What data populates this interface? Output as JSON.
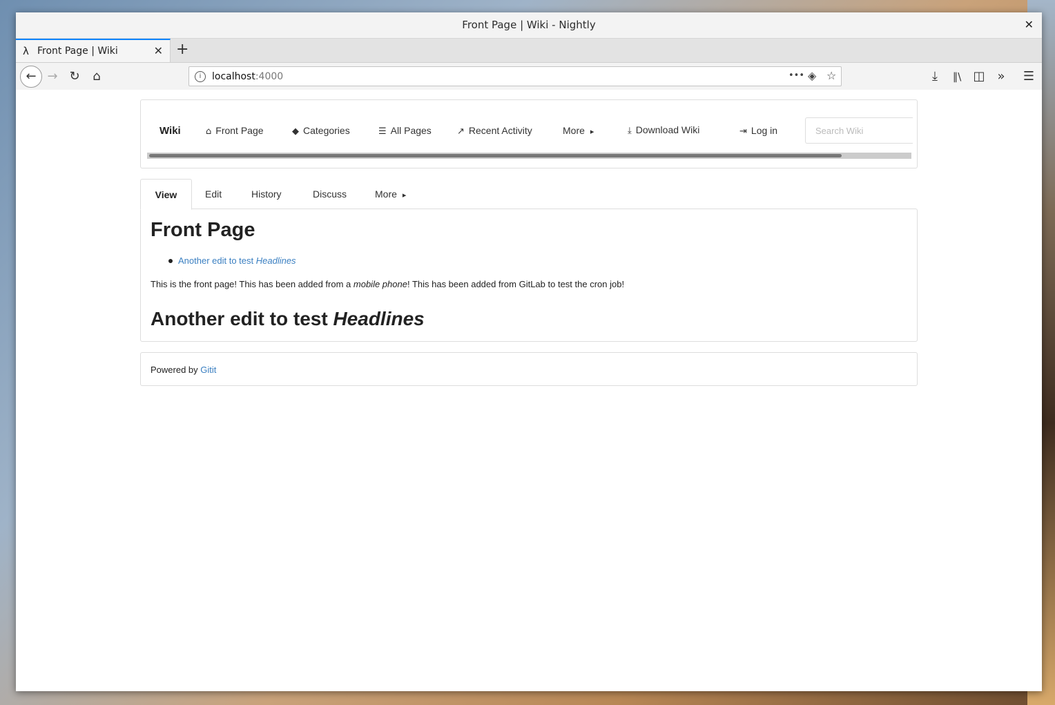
{
  "window": {
    "title": "Front Page | Wiki - Nightly",
    "close_glyph": "✕"
  },
  "browser": {
    "tab": {
      "favicon": "λ",
      "label": "Front Page | Wiki",
      "close_glyph": "✕"
    },
    "new_tab_glyph": "+",
    "url": {
      "host": "localhost",
      "port": ":4000"
    },
    "icons": {
      "back": "←",
      "forward": "→",
      "reload": "↻",
      "home": "⌂",
      "more": "•••",
      "pocket": "◈",
      "star": "☆",
      "download": "⤓",
      "library": "∥\\",
      "sidebar": "◫",
      "overflow": "»",
      "menu": "☰",
      "info": "i"
    }
  },
  "wiki_nav": {
    "brand": "Wiki",
    "items": [
      {
        "icon": "⌂",
        "label": "Front Page"
      },
      {
        "icon": "◆",
        "label": "Categories"
      },
      {
        "icon": "☰",
        "label": "All Pages"
      },
      {
        "icon": "↗",
        "label": "Recent Activity"
      },
      {
        "icon": "▸",
        "label": "More"
      },
      {
        "icon": "⤓",
        "label": "Download Wiki"
      },
      {
        "icon": "⇥",
        "label": "Log in"
      }
    ],
    "search_placeholder": "Search Wiki"
  },
  "page_tabs": [
    "View",
    "Edit",
    "History",
    "Discuss",
    "More"
  ],
  "page_tabs_more_caret": "▸",
  "content": {
    "title": "Front Page",
    "toc_link": {
      "text": "Another edit to test ",
      "em": "Headlines"
    },
    "paragraph": {
      "before": "This is the front page! This has been added from a ",
      "em": "mobile phone",
      "after": "! This has been added from GitLab to test the cron job!"
    },
    "heading2": {
      "text": "Another edit to test ",
      "em": "Headlines"
    }
  },
  "footer": {
    "text": "Powered by ",
    "link": "Gitit"
  }
}
